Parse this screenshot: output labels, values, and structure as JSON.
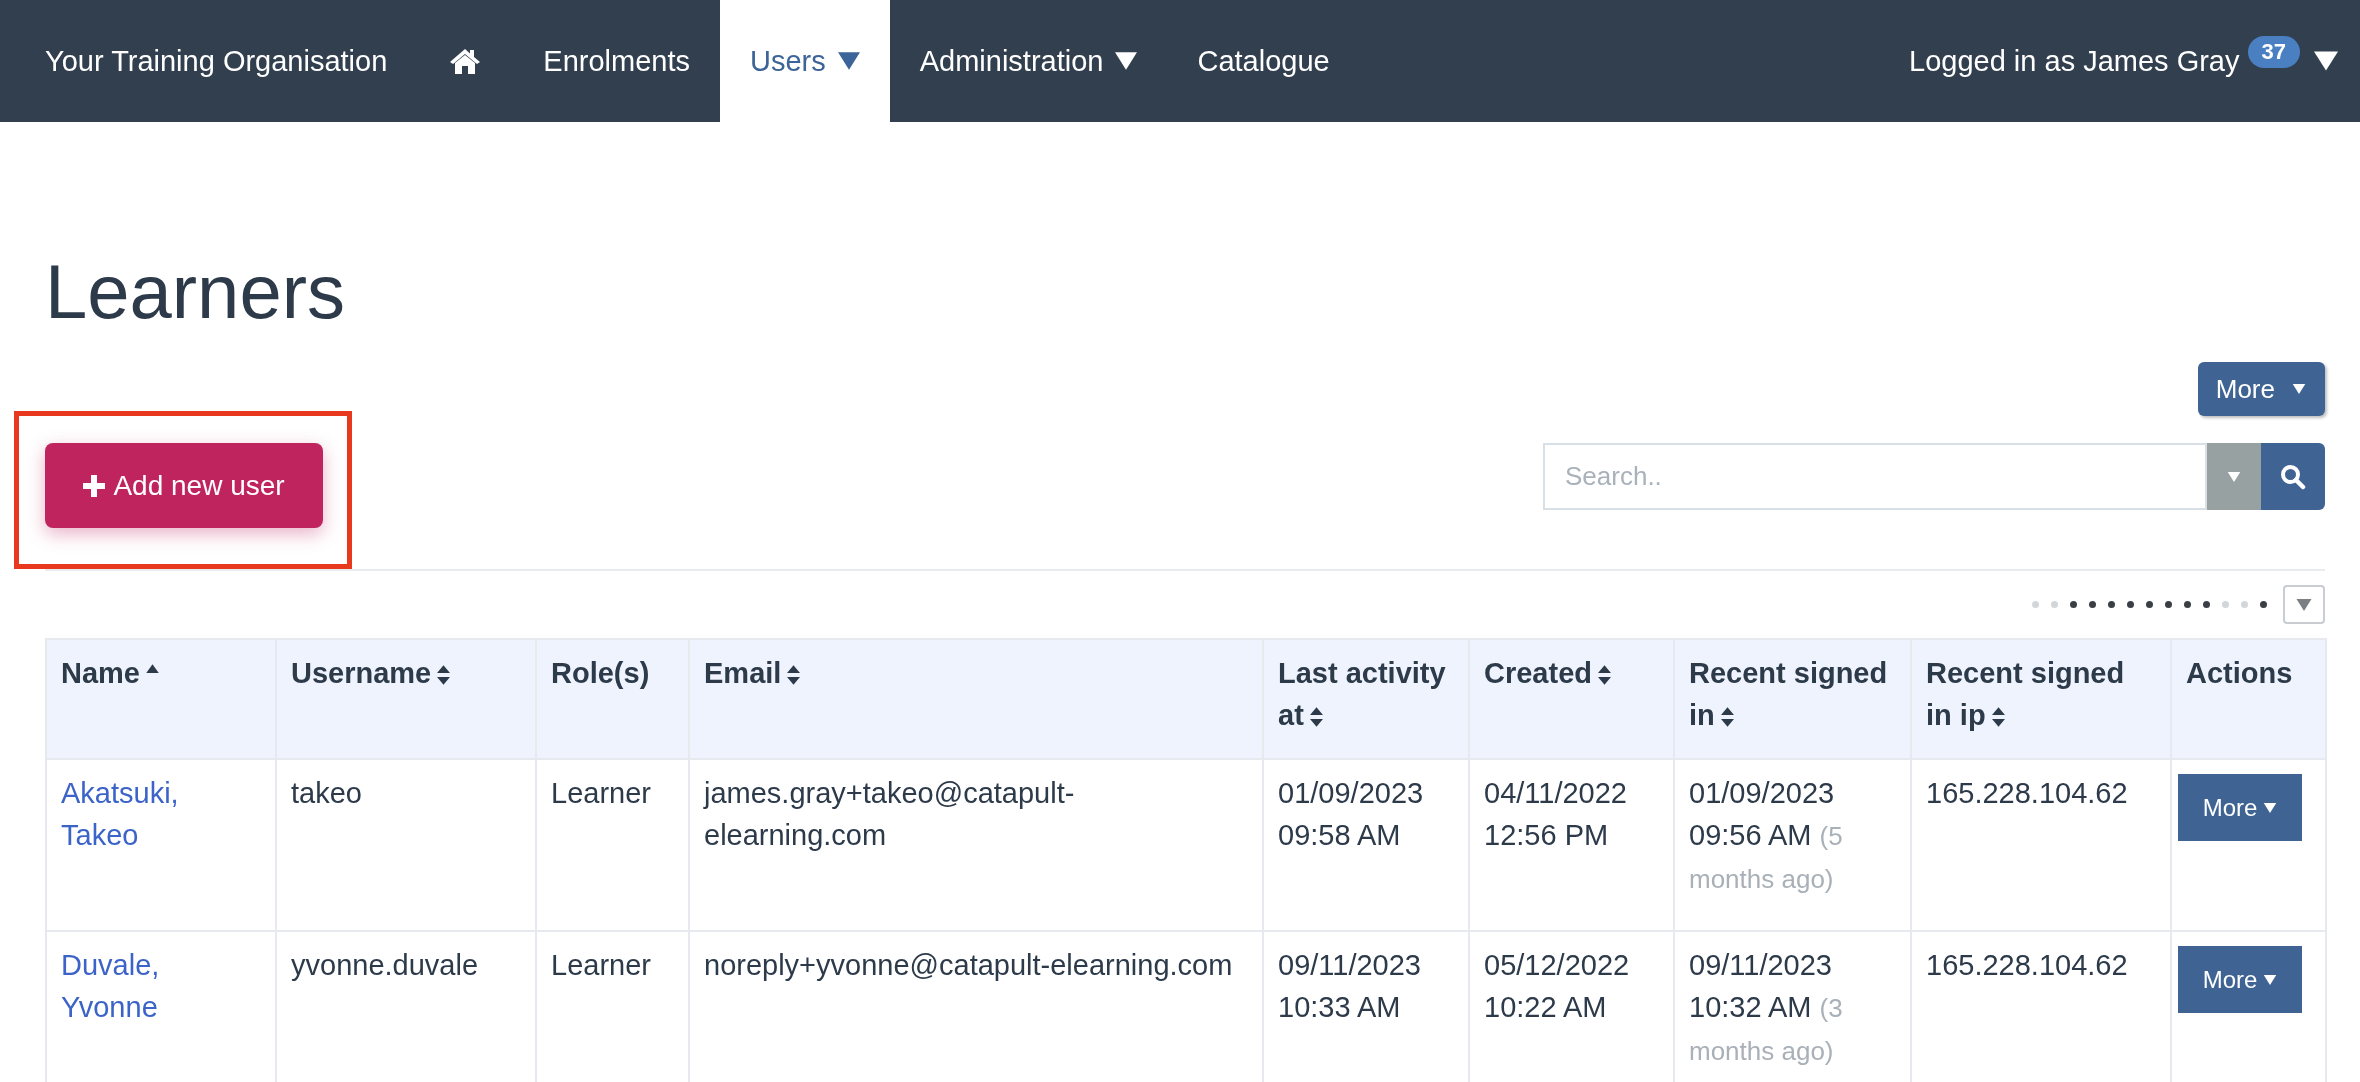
{
  "nav": {
    "items": [
      {
        "kind": "brand",
        "label": "Your Training Organisation",
        "selected": false,
        "dropdown": false
      },
      {
        "kind": "home",
        "selected": false,
        "dropdown": false
      },
      {
        "kind": "link",
        "label": "Enrolments",
        "selected": false,
        "dropdown": false
      },
      {
        "kind": "link",
        "label": "Users",
        "selected": true,
        "dropdown": true
      },
      {
        "kind": "link",
        "label": "Administration",
        "selected": false,
        "dropdown": true
      },
      {
        "kind": "link",
        "label": "Catalogue",
        "selected": false,
        "dropdown": false
      }
    ],
    "user": {
      "label": "Logged in as James Gray",
      "badge": "37"
    }
  },
  "page": {
    "title": "Learners",
    "more_button": "More",
    "add_button": "Add new user",
    "highlighted": true,
    "search": {
      "placeholder": "Search.."
    },
    "pager": {
      "dots": [
        {
          "on": false
        },
        {
          "on": false
        },
        {
          "on": true
        },
        {
          "on": true
        },
        {
          "on": true
        },
        {
          "on": true
        },
        {
          "on": true
        },
        {
          "on": true
        },
        {
          "on": true
        },
        {
          "on": true
        },
        {
          "on": false
        },
        {
          "on": false
        },
        {
          "on": true
        }
      ]
    }
  },
  "table": {
    "columns": [
      {
        "label": "Name",
        "sortable": true,
        "sorted": true
      },
      {
        "label": "Username",
        "sortable": true,
        "sorted": false
      },
      {
        "label": "Role(s)",
        "sortable": false,
        "sorted": false
      },
      {
        "label": "Email",
        "sortable": true,
        "sorted": false
      },
      {
        "label": "Last activity at",
        "sortable": true,
        "sorted": false
      },
      {
        "label": "Created",
        "sortable": true,
        "sorted": false
      },
      {
        "label": "Recent signed in",
        "sortable": true,
        "sorted": false
      },
      {
        "label": "Recent signed in ip",
        "sortable": true,
        "sorted": false
      },
      {
        "label": "Actions",
        "sortable": false,
        "sorted": false
      }
    ],
    "rows": [
      {
        "name": "Akatsuki, Takeo",
        "username": "takeo",
        "roles": "Learner",
        "email": "james.gray+takeo@catapult-elearning.com",
        "last_activity": "01/09/2023 09:58 AM",
        "created": "04/11/2022 12:56 PM",
        "recent_signed_in": "01/09/2023 09:56 AM",
        "recent_relative": "(5 months ago)",
        "ip": "165.228.104.62",
        "action": "More"
      },
      {
        "name": "Duvale, Yvonne",
        "username": "yvonne.duvale",
        "roles": "Learner",
        "email": "noreply+yvonne@catapult-elearning.com",
        "last_activity": "09/11/2023 10:33 AM",
        "created": "05/12/2022 10:22 AM",
        "recent_signed_in": "09/11/2023 10:32 AM",
        "recent_relative": "(3 months ago)",
        "ip": "165.228.104.62",
        "action": "More"
      }
    ]
  }
}
